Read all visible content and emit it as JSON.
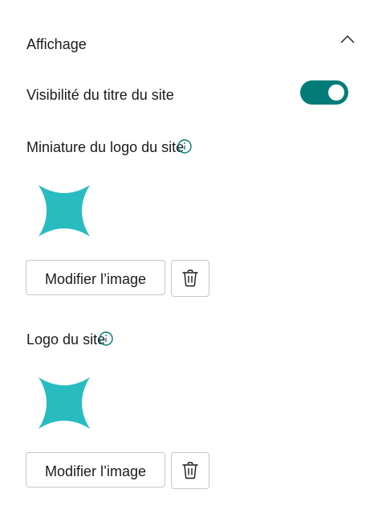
{
  "colors": {
    "accent": "#037c78",
    "logo": "#28bcc0",
    "text": "#1b1b1b",
    "border": "#c8c8c8"
  },
  "section": {
    "title": "Affichage",
    "expanded": true,
    "chevron_icon": "chevron-up-icon"
  },
  "site_title_visibility": {
    "label": "Visibilité du titre du site",
    "enabled": true
  },
  "thumbnail": {
    "label": "Miniature du logo du site",
    "info_icon": "info-icon",
    "modify_label": "Modifier l’image",
    "delete_icon": "trash-icon"
  },
  "site_logo": {
    "label": "Logo du site",
    "info_icon": "info-icon",
    "modify_label": "Modifier l’image",
    "delete_icon": "trash-icon"
  }
}
